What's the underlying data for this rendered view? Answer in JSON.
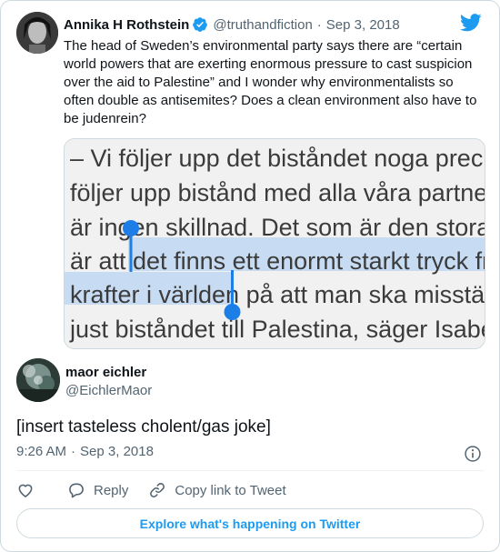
{
  "quoted": {
    "name": "Annika H Rothstein",
    "handle": "@truthandfiction",
    "separator": "·",
    "date": "Sep 3, 2018",
    "text": "The head of Sweden’s environmental party says there are “certain world powers that are exerting enormous pressure to cast suspicion over the aid to Palestine” and I wonder why environmentalists so often double as antisemites? Does a clean environment also have to be judenrein?",
    "media_lines": [
      "– Vi följer upp det biståndet noga precis",
      "följer upp bistånd med alla våra partnerla",
      "är ingen skillnad. Det som är den stora s",
      "är att det finns ett enormt starkt tryck frå",
      "krafter i världen på att man ska misstänk",
      "just biståndet till Palestina, säger Isabell"
    ],
    "highlight_color": "#c7dcf3",
    "handle_color": "#1d7ee8"
  },
  "tweet": {
    "name": "maor eichler",
    "handle": "@EichlerMaor",
    "text": "[insert tasteless cholent/gas joke]",
    "time": "9:26 AM",
    "separator": "·",
    "date": "Sep 3, 2018"
  },
  "actions": {
    "reply_label": "Reply",
    "copy_label": "Copy link to Tweet"
  },
  "explore_label": "Explore what's happening on Twitter",
  "colors": {
    "brand": "#1d9bf0",
    "text": "#0f1419",
    "muted": "#536471",
    "border": "#cfd9de"
  },
  "icons": [
    "verified-badge-icon",
    "twitter-bird-icon",
    "info-icon",
    "heart-icon",
    "reply-icon",
    "link-icon"
  ]
}
